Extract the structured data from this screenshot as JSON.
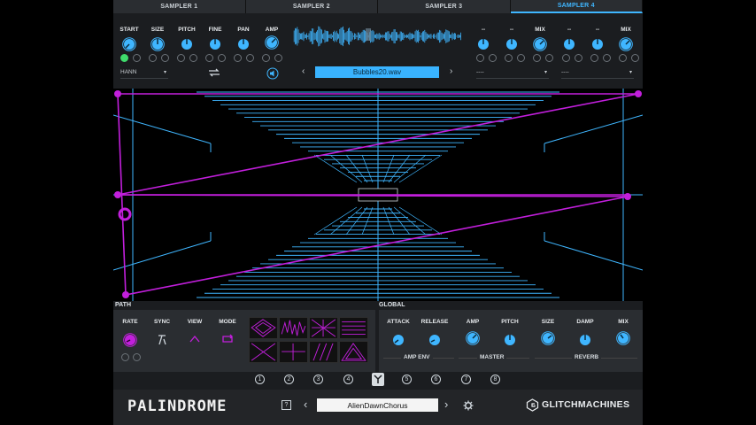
{
  "tabs": [
    {
      "label": "SAMPLER 1"
    },
    {
      "label": "SAMPLER 2"
    },
    {
      "label": "SAMPLER 3"
    },
    {
      "label": "SAMPLER 4"
    }
  ],
  "active_tab": 3,
  "sampler": {
    "knobs": [
      "START",
      "SIZE",
      "PITCH",
      "FINE",
      "PAN",
      "AMP"
    ],
    "right_knobs": [
      "--",
      "--",
      "MIX",
      "--",
      "--",
      "MIX"
    ],
    "window_select": "HANN",
    "file_name": "Bubbles20.wav",
    "left_dropdown": "----",
    "right_dropdown": "----"
  },
  "labels": {
    "path": "PATH",
    "global": "GLOBAL"
  },
  "path_panel": {
    "knobs": [
      "RATE",
      "SYNC",
      "VIEW",
      "MODE"
    ]
  },
  "global_panel": {
    "knobs": [
      "ATTACK",
      "RELEASE",
      "AMP",
      "PITCH",
      "SIZE",
      "DAMP",
      "MIX"
    ],
    "groups": [
      "AMP ENV",
      "MASTER",
      "REVERB"
    ]
  },
  "slots": [
    "1",
    "2",
    "3",
    "4",
    "",
    "5",
    "6",
    "7",
    "8"
  ],
  "footer": {
    "logo": "PALINDROME",
    "help": "?",
    "preset": "AlienDawnChorus",
    "brand": "GLITCHMACHINES"
  },
  "colors": {
    "accent": "#3fb6ff",
    "path": "#c21fdc",
    "bg": "#1b1d20"
  },
  "icons": [
    "settings-gear-icon",
    "speaker-icon",
    "loop-icon",
    "sync-icon",
    "chevron-left-icon",
    "chevron-right-icon"
  ]
}
